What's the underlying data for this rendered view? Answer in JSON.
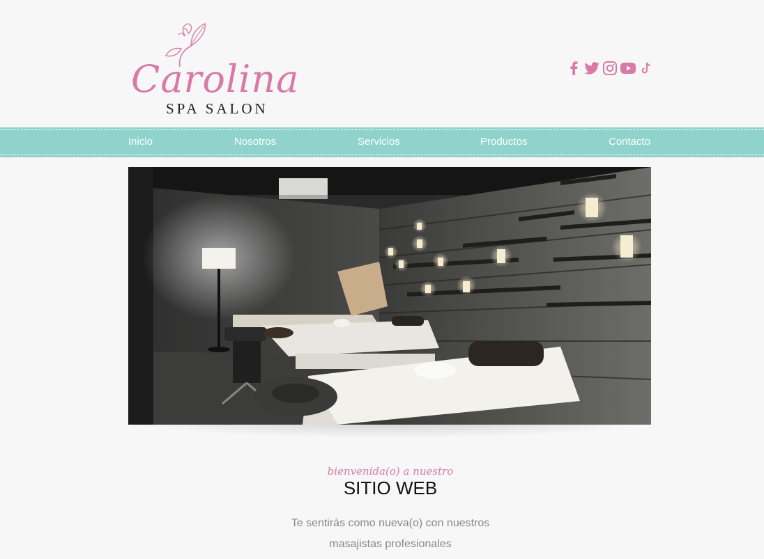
{
  "brand": {
    "name": "Carolina",
    "tagline": "SPA SALON"
  },
  "social": [
    {
      "icon": "facebook-icon"
    },
    {
      "icon": "twitter-icon"
    },
    {
      "icon": "instagram-icon"
    },
    {
      "icon": "youtube-icon"
    },
    {
      "icon": "tiktok-icon"
    }
  ],
  "nav": {
    "items": [
      {
        "label": "Inicio"
      },
      {
        "label": "Nosotros"
      },
      {
        "label": "Servicios"
      },
      {
        "label": "Productos"
      },
      {
        "label": "Contacto"
      }
    ]
  },
  "welcome": {
    "kicker": "bienvenida(o) a nuestro",
    "title": "SITIO WEB",
    "line1": "Te sentirás como nueva(o) con nuestros",
    "line2": "masajistas profesionales"
  },
  "colors": {
    "accent_pink": "#d97aa6",
    "nav_teal": "#8fd3cc",
    "background": "#f7f7f7"
  }
}
